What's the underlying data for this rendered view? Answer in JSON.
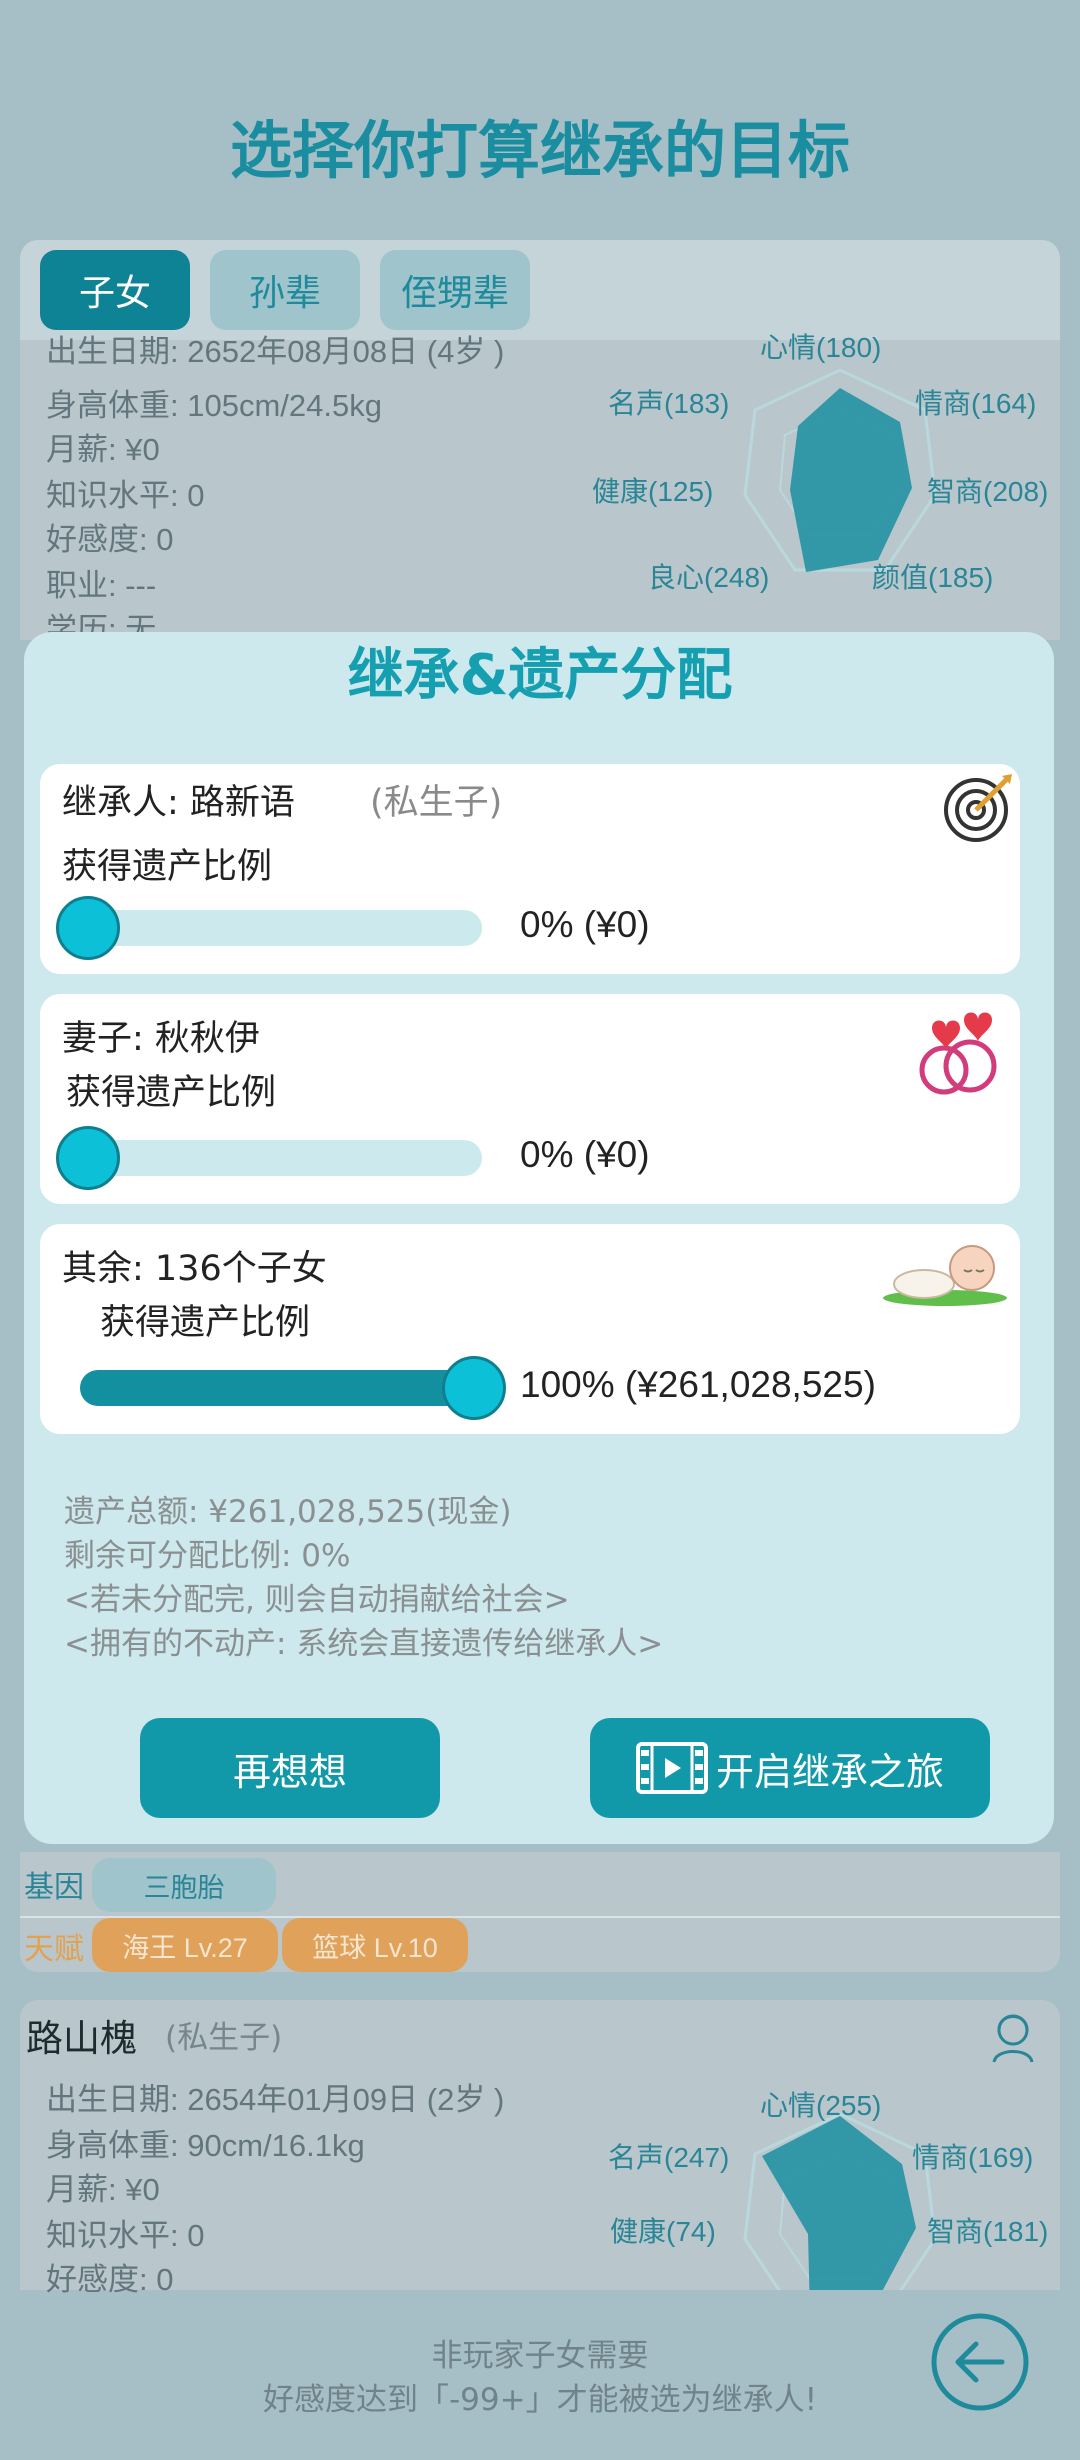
{
  "header": {
    "title": "选择你打算继承的目标"
  },
  "tabs": [
    {
      "label": "子女"
    },
    {
      "label": "孙辈"
    },
    {
      "label": "侄甥辈"
    }
  ],
  "child1": {
    "lines": [
      "出生日期: 2652年08月08日 (4岁 )",
      "身高体重: 105cm/24.5kg",
      "月薪: ¥0",
      "知识水平: 0",
      "好感度: 0",
      "职业: ---",
      "学历: 无"
    ],
    "radar": {
      "mood": "心情(180)",
      "fame": "名声(183)",
      "eq": "情商(164)",
      "health": "健康(125)",
      "iq": "智商(208)",
      "conscience": "良心(248)",
      "looks": "颜值(185)"
    }
  },
  "modal": {
    "title": "继承&遗产分配",
    "heir": {
      "label": "继承人:  路新语",
      "note": "(私生子)",
      "ratio_label": "获得遗产比例",
      "percent": 0,
      "value_text": "0% (¥0)"
    },
    "spouse": {
      "label": "妻子:  秋秋伊",
      "ratio_label": "获得遗产比例",
      "percent": 0,
      "value_text": "0% (¥0)"
    },
    "others": {
      "label": "其余:  136个子女",
      "ratio_label": "获得遗产比例",
      "percent": 100,
      "value_text": "100% (¥261,028,525)"
    },
    "summary": [
      "遗产总额:  ¥261,028,525(现金)",
      "剩余可分配比例:  0%",
      "<若未分配完, 则会自动捐献给社会>",
      "<拥有的不动产:  系统会直接遗传给继承人>"
    ],
    "buttons": {
      "rethink": "再想想",
      "start": "开启继承之旅"
    }
  },
  "traits": {
    "gene_label": "基因",
    "genes": [
      "三胞胎"
    ],
    "talent_label": "天赋",
    "talents": [
      "海王 Lv.27",
      "篮球 Lv.10"
    ]
  },
  "child2": {
    "name": "路山槐",
    "note": "(私生子)",
    "lines": [
      "出生日期: 2654年01月09日 (2岁 )",
      "身高体重: 90cm/16.1kg",
      "月薪: ¥0",
      "知识水平: 0",
      "好感度: 0"
    ],
    "radar": {
      "mood": "心情(255)",
      "fame": "名声(247)",
      "eq": "情商(169)",
      "health": "健康(74)",
      "iq": "智商(181)"
    }
  },
  "footer": {
    "line1": "非玩家子女需要",
    "line2": "好感度达到「-99+」才能被选为继承人!"
  },
  "colors": {
    "background": "#a6bfc6",
    "accent": "#1299a9",
    "title": "#1a8ea0",
    "knob": "#0cc0d8",
    "talent": "#e0a25a"
  }
}
